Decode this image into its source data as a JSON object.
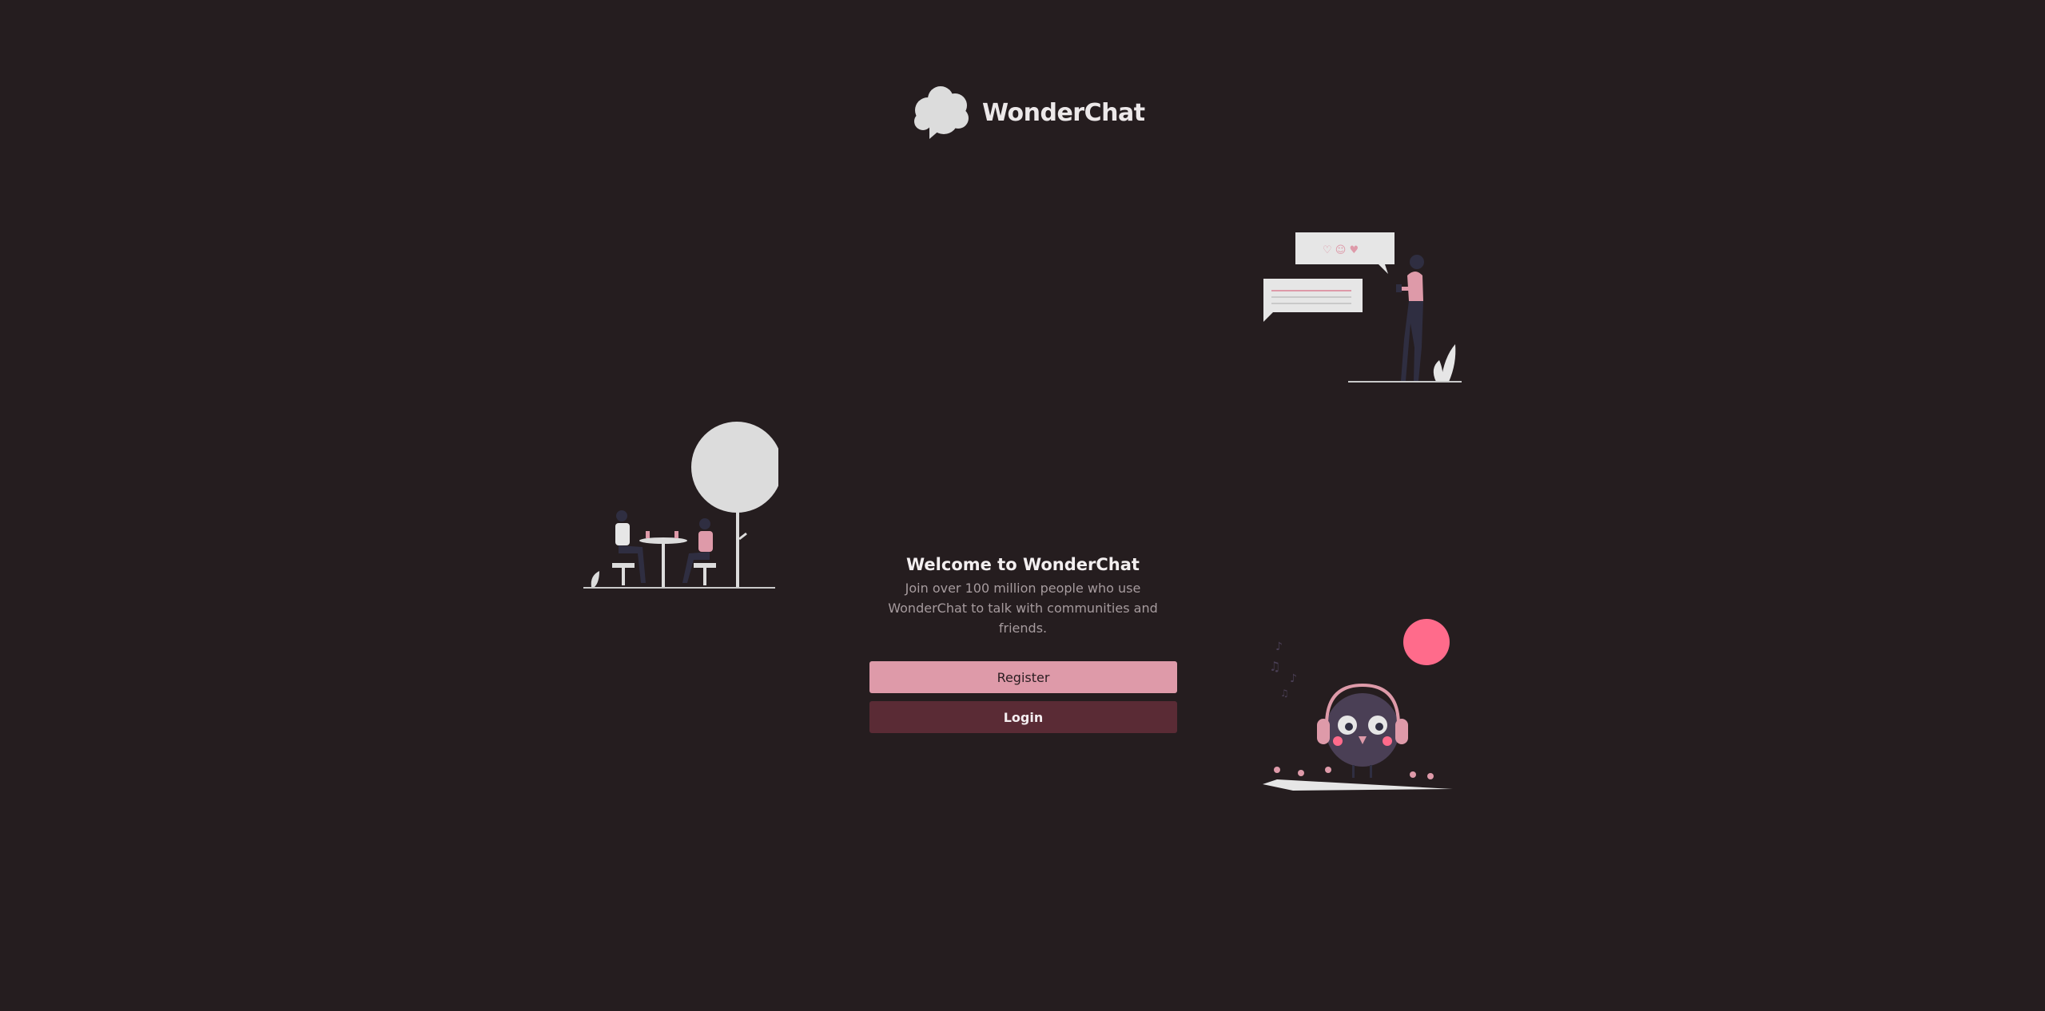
{
  "brand": {
    "name": "WonderChat",
    "logo_icon": "chat-cloud-icon"
  },
  "welcome": {
    "title": "Welcome to WonderChat",
    "subtitle": "Join over 100 million people who use WonderChat to talk with communities and friends."
  },
  "buttons": {
    "register_label": "Register",
    "login_label": "Login"
  },
  "illustrations": {
    "top_right": "woman-with-chat-bubbles-illustration",
    "left": "cafe-conversation-illustration",
    "bottom_right": "bird-with-headphones-illustration"
  },
  "colors": {
    "background": "#251d1f",
    "accent_pink": "#de9aa9",
    "accent_dark": "#5a2b35",
    "circle_pink": "#ff6b8b",
    "light_gray": "#dcdcdc"
  }
}
